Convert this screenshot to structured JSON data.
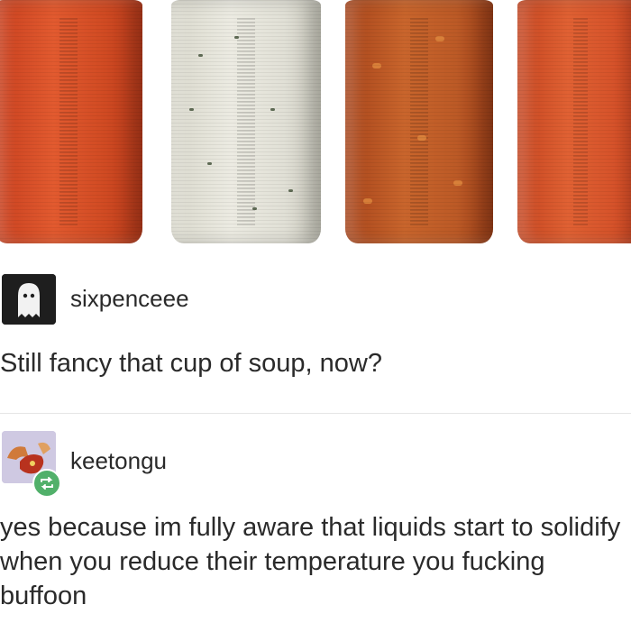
{
  "image": {
    "label": "canned soup cylinders",
    "cans": [
      "tomato-soup-can",
      "cream-soup-can",
      "chunky-soup-can",
      "tomato-soup-can-2"
    ]
  },
  "post_1": {
    "username": "sixpenceee",
    "text": "Still fancy that cup of soup, now?",
    "avatar_icon": "ghost-icon"
  },
  "post_2": {
    "username": "keetongu",
    "text": "yes because im fully aware that liquids start to solidify when you reduce their temperature you fucking buffoon",
    "avatar_icon": "creature-icon",
    "badge_icon": "reblog-icon"
  },
  "colors": {
    "reblog_badge": "#51b06a",
    "text": "#2a2a2a"
  }
}
